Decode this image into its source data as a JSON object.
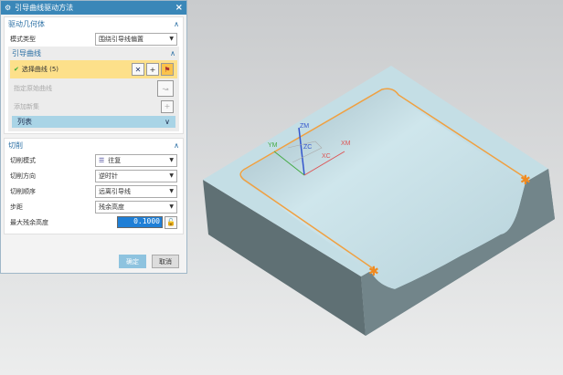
{
  "dialog": {
    "title": "引导曲线驱动方法",
    "close": "×",
    "drive_geometry": {
      "header": "驱动几何体",
      "mode_label": "模式类型",
      "mode_value": "围绕引导线偏置",
      "guide": {
        "header": "引导曲线",
        "select_curve": "选择曲线 (5)",
        "specify_original": "指定原始曲线",
        "add_new_set": "添加新集",
        "list": "列表"
      }
    },
    "cutting": {
      "header": "切削",
      "rows": [
        {
          "label": "切削模式",
          "value": "往复"
        },
        {
          "label": "切削方向",
          "value": "逆时针"
        },
        {
          "label": "切削顺序",
          "value": "远离引导线"
        },
        {
          "label": "步距",
          "value": "残余高度"
        }
      ],
      "max_residual_label": "最大残余高度",
      "max_residual_value": "0.1000"
    },
    "ok": "确定",
    "cancel": "取消"
  },
  "viewport": {
    "axes": {
      "zm": "ZM",
      "zc": "ZC",
      "ym": "YM",
      "xm": "XM",
      "xc": "XC"
    },
    "curve_color": "#f0a040"
  }
}
